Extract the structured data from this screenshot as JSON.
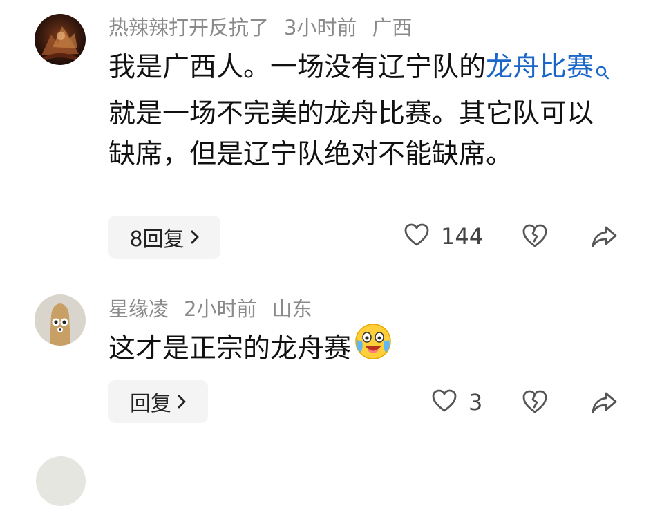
{
  "comments": [
    {
      "username": "热辣辣打开反抗了",
      "time": "3小时前",
      "location": "广西",
      "text_before": "我是广西人。一场没有辽宁队的",
      "link_text": "龙舟比赛",
      "text_after": "就是一场不完美的龙舟比赛。其它队可以缺席，但是辽宁队绝对不能缺席。",
      "reply_label": "8回复",
      "like_count": "144"
    },
    {
      "username": "星缘凌",
      "time": "2小时前",
      "location": "山东",
      "text": "这才是正宗的龙舟赛",
      "emoji": "crying-laughing-emoji",
      "reply_label": "回复",
      "like_count": "3"
    }
  ],
  "icons": {
    "like": "heart-outline-icon",
    "dislike": "broken-heart-icon",
    "share": "share-arrow-icon",
    "chevron": "chevron-right-icon"
  },
  "colors": {
    "meta_gray": "#8a8a8a",
    "link_blue": "#1b66c9",
    "button_bg": "#f4f4f4",
    "text": "#111111"
  }
}
